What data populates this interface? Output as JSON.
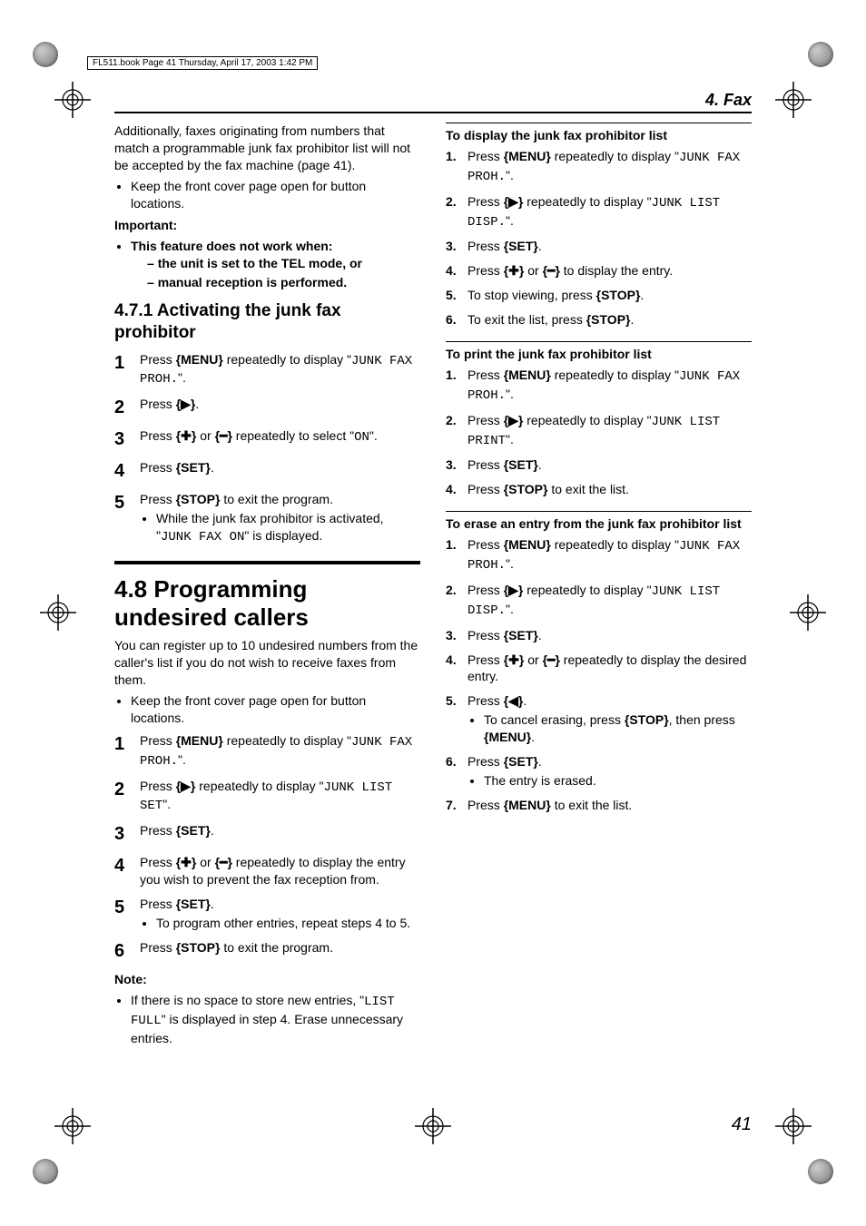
{
  "print_header": "FL511.book  Page 41  Thursday, April 17, 2003  1:42 PM",
  "chapter": "4. Fax",
  "page_number": "41",
  "left": {
    "intro1": "Additionally, faxes originating from numbers that match a programmable junk fax prohibitor list will not be accepted by the fax machine (page 41).",
    "intro_bullet": "Keep the front cover page open for button locations.",
    "important_label": "Important:",
    "imp1": "This feature does not work when:",
    "imp1a": "the unit is set to the TEL mode, or",
    "imp1b": "manual reception is performed.",
    "h471": "4.7.1 Activating the junk fax prohibitor",
    "s1a": "Press ",
    "s1_btn": "MENU",
    "s1b": " repeatedly to display \"",
    "s1_mono": "JUNK FAX PROH.",
    "s1c": "\".",
    "s2a": "Press ",
    "s2_btn": "▶",
    "s2b": ".",
    "s3a": "Press ",
    "s3_btn1": "✚",
    "s3_mid": " or ",
    "s3_btn2": "━",
    "s3b": " repeatedly to select \"",
    "s3_mono": "ON",
    "s3c": "\".",
    "s4a": "Press ",
    "s4_btn": "SET",
    "s4b": ".",
    "s5a": "Press ",
    "s5_btn": "STOP",
    "s5b": " to exit the program.",
    "s5_bullet_a": "While the junk fax prohibitor is activated, \"",
    "s5_bullet_mono": "JUNK FAX ON",
    "s5_bullet_b": "\" is displayed.",
    "h48": "4.8 Programming undesired callers",
    "p48_intro": "You can register up to 10 undesired numbers from the caller's list if you do not wish to receive faxes from them.",
    "p48_bullet": "Keep the front cover page open for button locations.",
    "p48_s1a": "Press ",
    "p48_s1_btn": "MENU",
    "p48_s1b": " repeatedly to display \"",
    "p48_s1_mono": "JUNK FAX PROH.",
    "p48_s1c": "\".",
    "p48_s2a": "Press ",
    "p48_s2_btn": "▶",
    "p48_s2b": " repeatedly to display \"",
    "p48_s2_mono": "JUNK LIST SET",
    "p48_s2c": "\".",
    "p48_s3a": "Press ",
    "p48_s3_btn": "SET",
    "p48_s3b": ".",
    "p48_s4a": "Press ",
    "p48_s4_btn1": "✚",
    "p48_s4mid": " or ",
    "p48_s4_btn2": "━",
    "p48_s4b": " repeatedly to display the entry you wish to prevent the fax reception from.",
    "p48_s5a": "Press ",
    "p48_s5_btn": "SET",
    "p48_s5b": ".",
    "p48_s5_bullet": "To program other entries, repeat steps 4 to 5.",
    "p48_s6a": "Press ",
    "p48_s6_btn": "STOP",
    "p48_s6b": " to exit the program.",
    "note_label": "Note:",
    "note_a": "If there is no space to store new entries, \"",
    "note_mono": "LIST FULL",
    "note_b": "\" is displayed in step 4. Erase unnecessary entries."
  },
  "right": {
    "h_disp": "To display the junk fax prohibitor list",
    "d1a": "Press ",
    "d1_btn": "MENU",
    "d1b": " repeatedly to display \"",
    "d1_mono": "JUNK FAX PROH.",
    "d1c": "\".",
    "d2a": "Press ",
    "d2_btn": "▶",
    "d2b": " repeatedly to display \"",
    "d2_mono": "JUNK LIST DISP.",
    "d2c": "\".",
    "d3a": "Press ",
    "d3_btn": "SET",
    "d3b": ".",
    "d4a": "Press ",
    "d4_btn1": "✚",
    "d4mid": " or ",
    "d4_btn2": "━",
    "d4b": " to display the entry.",
    "d5a": "To stop viewing, press ",
    "d5_btn": "STOP",
    "d5b": ".",
    "d6a": "To exit the list, press ",
    "d6_btn": "STOP",
    "d6b": ".",
    "h_print": "To print the junk fax prohibitor list",
    "p1a": "Press ",
    "p1_btn": "MENU",
    "p1b": " repeatedly to display \"",
    "p1_mono": "JUNK FAX PROH.",
    "p1c": "\".",
    "p2a": "Press ",
    "p2_btn": "▶",
    "p2b": " repeatedly to display \"",
    "p2_mono": "JUNK LIST PRINT",
    "p2c": "\".",
    "p3a": "Press ",
    "p3_btn": "SET",
    "p3b": ".",
    "p4a": "Press ",
    "p4_btn": "STOP",
    "p4b": " to exit the list.",
    "h_erase": "To erase an entry from the junk fax prohibitor list",
    "e1a": "Press ",
    "e1_btn": "MENU",
    "e1b": " repeatedly to display \"",
    "e1_mono": "JUNK FAX PROH.",
    "e1c": "\".",
    "e2a": "Press ",
    "e2_btn": "▶",
    "e2b": " repeatedly to display \"",
    "e2_mono": "JUNK LIST DISP.",
    "e2c": "\".",
    "e3a": "Press ",
    "e3_btn": "SET",
    "e3b": ".",
    "e4a": "Press ",
    "e4_btn1": "✚",
    "e4mid": " or ",
    "e4_btn2": "━",
    "e4b": " repeatedly to display the desired entry.",
    "e5a": "Press ",
    "e5_btn": "◀",
    "e5b": ".",
    "e5_bullet_a": "To cancel erasing, press ",
    "e5_bullet_btn1": "STOP",
    "e5_bullet_mid": ", then press ",
    "e5_bullet_btn2": "MENU",
    "e5_bullet_b": ".",
    "e6a": "Press ",
    "e6_btn": "SET",
    "e6b": ".",
    "e6_bullet": "The entry is erased.",
    "e7a": "Press ",
    "e7_btn": "MENU",
    "e7b": " to exit the list."
  }
}
